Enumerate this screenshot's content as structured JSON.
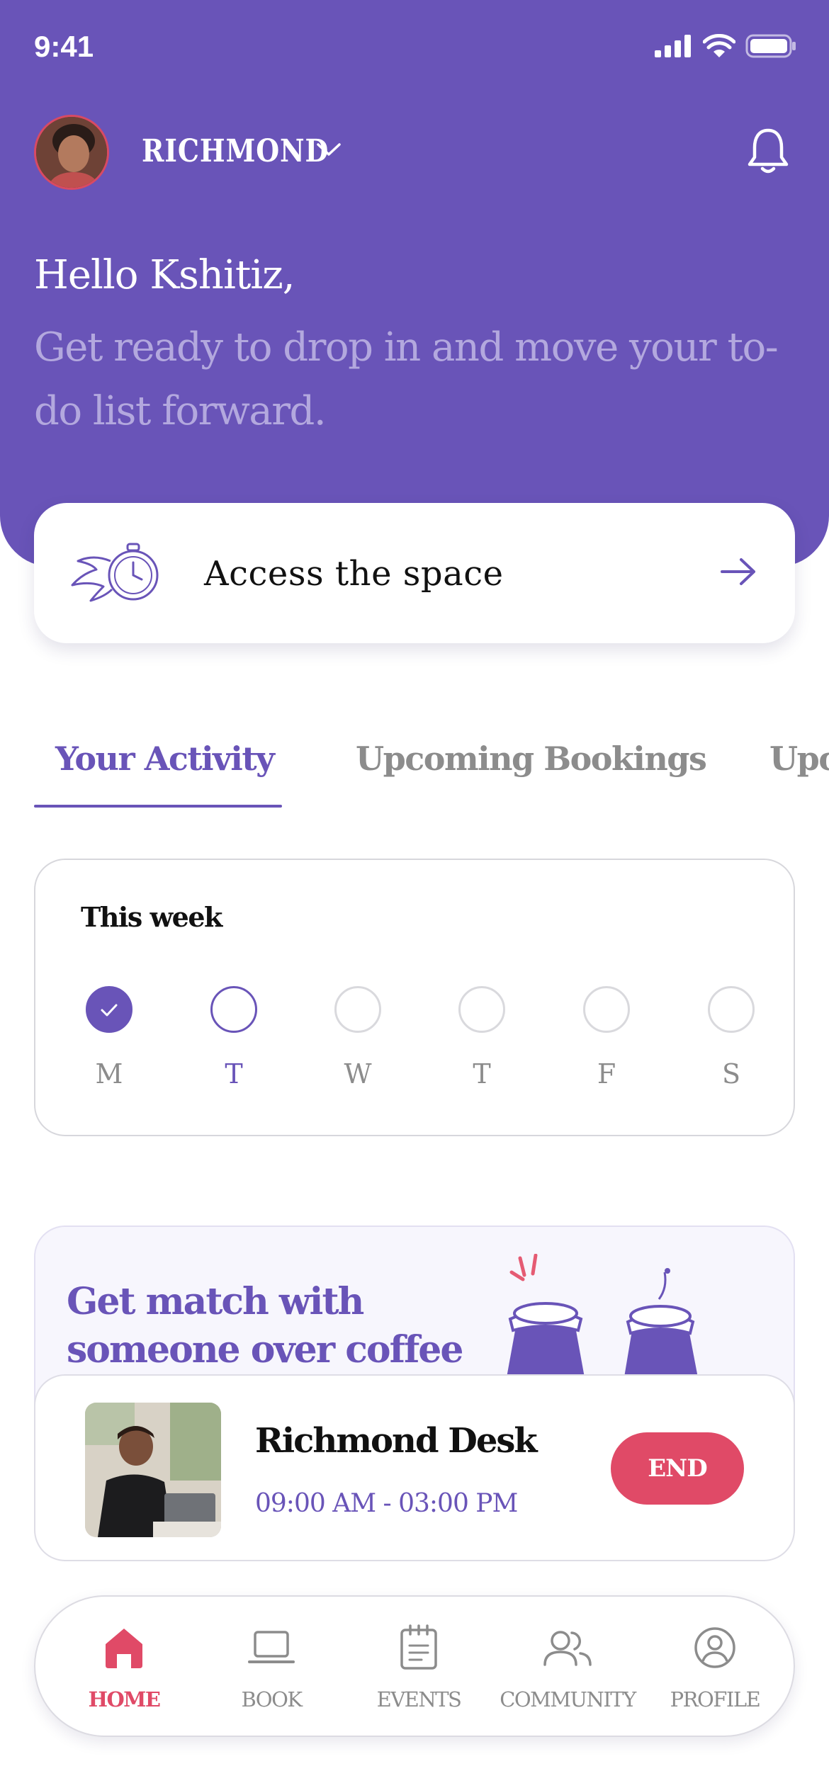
{
  "status_bar": {
    "time": "9:41"
  },
  "header": {
    "location": "RICHMOND",
    "greeting": "Hello Kshitiz,",
    "subtitle": "Get ready to drop in and move your to-do list forward."
  },
  "access_card": {
    "label": "Access the space"
  },
  "tabs": [
    {
      "label": "Your Activity",
      "active": true
    },
    {
      "label": "Upcoming Bookings",
      "active": false
    },
    {
      "label": "Upc",
      "active": false
    }
  ],
  "week": {
    "title": "This week",
    "days": [
      {
        "label": "M",
        "state": "done"
      },
      {
        "label": "T",
        "state": "today"
      },
      {
        "label": "W",
        "state": "pending"
      },
      {
        "label": "T",
        "state": "pending"
      },
      {
        "label": "F",
        "state": "pending"
      },
      {
        "label": "S",
        "state": "pending"
      }
    ]
  },
  "promo": {
    "title_line1": "Get match with",
    "title_line2": "someone over coffee"
  },
  "booking": {
    "title": "Richmond Desk",
    "time": "09:00 AM - 03:00 PM",
    "end_label": "END"
  },
  "nav": [
    {
      "label": "HOME",
      "icon": "home-icon",
      "active": true
    },
    {
      "label": "BOOK",
      "icon": "laptop-icon",
      "active": false
    },
    {
      "label": "EVENTS",
      "icon": "calendar-icon",
      "active": false
    },
    {
      "label": "COMMUNITY",
      "icon": "people-icon",
      "active": false
    },
    {
      "label": "PROFILE",
      "icon": "profile-icon",
      "active": false
    }
  ],
  "colors": {
    "primary": "#6954b8",
    "accent": "#e04a67",
    "muted": "#8c8c8c"
  }
}
